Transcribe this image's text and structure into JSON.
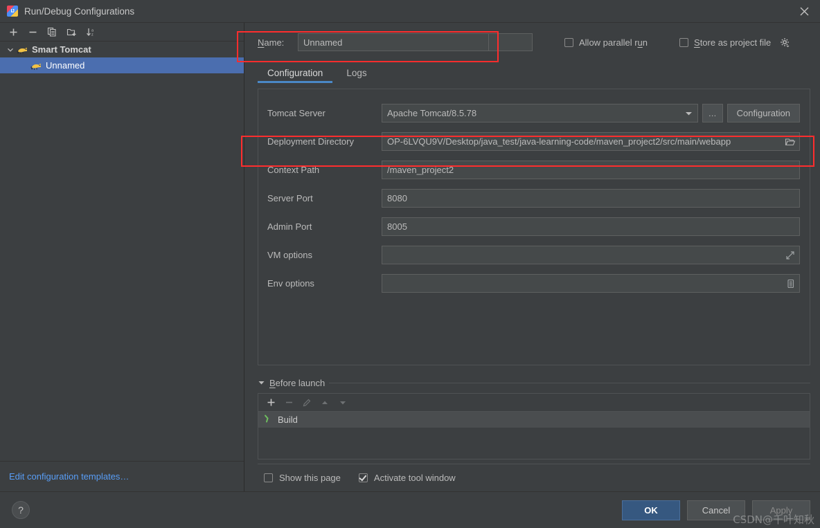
{
  "window": {
    "title": "Run/Debug Configurations",
    "app_icon": "intellij-idea-icon",
    "close_icon": "close-icon"
  },
  "tree_toolbar": {
    "buttons": [
      {
        "name": "add-configuration-button",
        "icon": "plus-icon",
        "label": "+"
      },
      {
        "name": "remove-configuration-button",
        "icon": "minus-icon",
        "label": "−"
      },
      {
        "name": "copy-configuration-button",
        "icon": "copy-icon",
        "label": ""
      },
      {
        "name": "new-folder-button",
        "icon": "folder-add-icon",
        "label": ""
      },
      {
        "name": "sort-configurations-button",
        "icon": "sort-alpha-icon",
        "label": ""
      }
    ]
  },
  "tree": {
    "items": [
      {
        "label": "Smart Tomcat",
        "icon": "tomcat-icon",
        "type": "group",
        "expanded": true,
        "selected": false
      },
      {
        "label": "Unnamed",
        "icon": "tomcat-icon",
        "type": "child",
        "expanded": false,
        "selected": true
      }
    ]
  },
  "edit_templates": {
    "label": "Edit configuration templates…"
  },
  "name_row": {
    "label": "Name:",
    "value": "Unnamed",
    "placeholder": "",
    "allow_parallel_run": {
      "label": "Allow parallel run",
      "checked": false
    },
    "store_as_project_file": {
      "label": "Store as project file",
      "checked": false,
      "gear_icon": "gear-icon"
    }
  },
  "tabs": [
    {
      "label": "Configuration",
      "active": true
    },
    {
      "label": "Logs",
      "active": false
    }
  ],
  "form": {
    "tomcat_server": {
      "label": "Tomcat Server",
      "value": "Apache Tomcat/8.5.78",
      "browse_label": "…",
      "configuration_label": "Configuration"
    },
    "deployment_directory": {
      "label": "Deployment Directory",
      "value": "OP-6LVQU9V/Desktop/java_test/java-learning-code/maven_project2/src/main/webapp",
      "icon": "folder-open-icon"
    },
    "context_path": {
      "label": "Context Path",
      "value": "/maven_project2"
    },
    "server_port": {
      "label": "Server Port",
      "value": "8080"
    },
    "admin_port": {
      "label": "Admin Port",
      "value": "8005"
    },
    "vm_options": {
      "label": "VM options",
      "value": "",
      "icon": "expand-icon"
    },
    "env_options": {
      "label": "Env options",
      "value": "",
      "icon": "list-icon"
    }
  },
  "before_launch": {
    "title": "Before launch",
    "collapsed": false,
    "toolbar": [
      {
        "name": "before-launch-add-button",
        "icon": "plus-icon",
        "label": "+"
      },
      {
        "name": "before-launch-remove-button",
        "icon": "minus-icon",
        "label": "−"
      },
      {
        "name": "before-launch-edit-button",
        "icon": "pencil-icon",
        "label": ""
      },
      {
        "name": "before-launch-move-up-button",
        "icon": "arrow-up-icon",
        "label": ""
      },
      {
        "name": "before-launch-move-down-button",
        "icon": "arrow-down-icon",
        "label": ""
      }
    ],
    "items": [
      {
        "label": "Build",
        "icon": "hammer-icon"
      }
    ]
  },
  "bottom_checks": {
    "show_this_page": {
      "label": "Show this page",
      "checked": false
    },
    "activate_tool_window": {
      "label": "Activate tool window",
      "checked": true
    }
  },
  "footer": {
    "help_label": "?",
    "ok_label": "OK",
    "cancel_label": "Cancel",
    "apply_label": "Apply"
  },
  "watermark": {
    "text": "CSDN@千叶知秋"
  },
  "colors": {
    "accent_blue": "#4a88c7",
    "selection_blue": "#4b6eaf",
    "primary_button": "#365880",
    "link_blue": "#589df6",
    "annotation_red": "#ff2d2d",
    "panel_bg": "#3c3f41",
    "input_bg": "#45494a",
    "build_icon_green": "#6fbf5f"
  }
}
